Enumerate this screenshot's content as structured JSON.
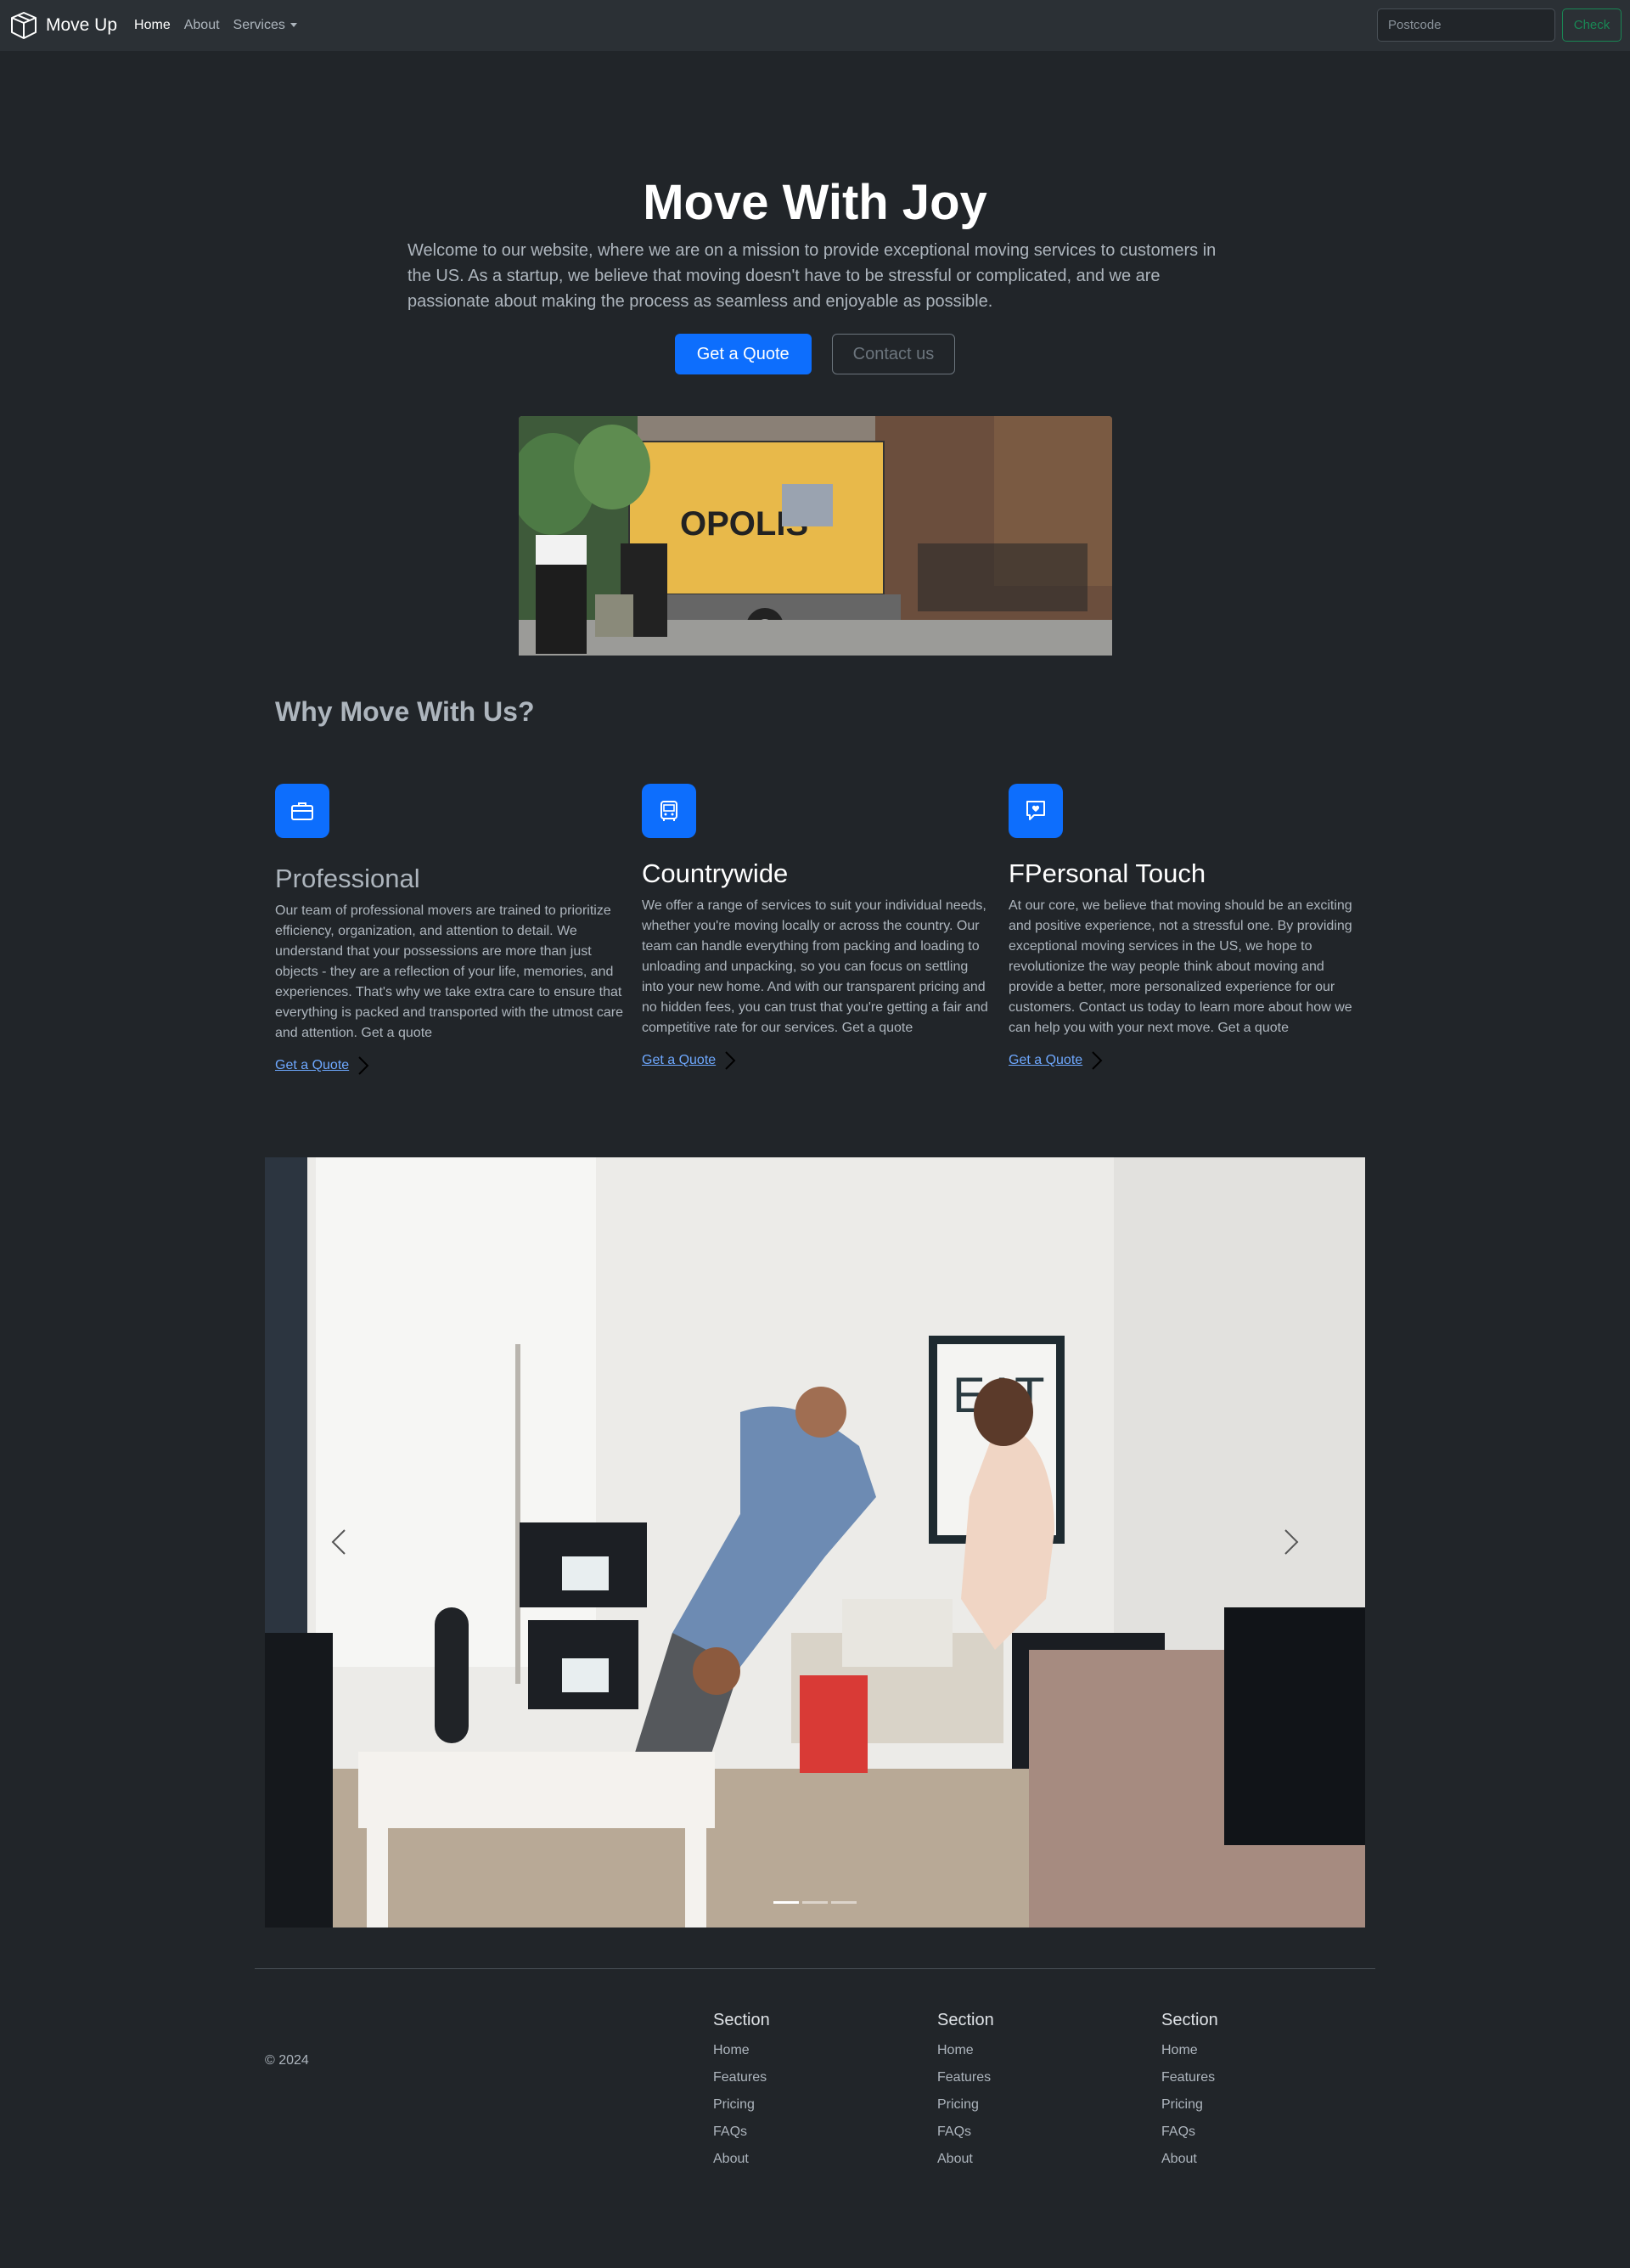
{
  "navbar": {
    "brand": "Move Up",
    "links": [
      {
        "label": "Home",
        "active": true
      },
      {
        "label": "About",
        "active": false
      }
    ],
    "services_label": "Services",
    "postcode_placeholder": "Postcode",
    "check_label": "Check"
  },
  "hero": {
    "title": "Move With Joy",
    "text": "Welcome to our website, where we are on a mission to provide exceptional moving services to customers in the US. As a startup, we believe that moving doesn't have to be stressful or complicated, and we are passionate about making the process as seamless and enjoyable as possible.",
    "primary_button": "Get a Quote",
    "secondary_button": "Contact us"
  },
  "why": {
    "title": "Why Move With Us?",
    "features": [
      {
        "icon": "briefcase-icon",
        "title": "Professional",
        "text": "Our team of professional movers are trained to prioritize efficiency, organization, and attention to detail. We understand that your possessions are more than just objects - they are a reflection of your life, memories, and experiences. That's why we take extra care to ensure that everything is packed and transported with the utmost care and attention. Get a quote",
        "link": "Get a Quote"
      },
      {
        "icon": "bus-icon",
        "title": "Countrywide",
        "text": "We offer a range of services to suit your individual needs, whether you're moving locally or across the country. Our team can handle everything from packing and loading to unloading and unpacking, so you can focus on settling into your new home. And with our transparent pricing and no hidden fees, you can trust that you're getting a fair and competitive rate for our services. Get a quote",
        "link": "Get a Quote"
      },
      {
        "icon": "heart-chat-icon",
        "title": "FPersonal Touch",
        "text": "At our core, we believe that moving should be an exciting and positive experience, not a stressful one. By providing exceptional moving services in the US, we hope to revolutionize the way people think about moving and provide a better, more personalized experience for our customers. Contact us today to learn more about how we can help you with your next move. Get a quote",
        "link": "Get a Quote"
      }
    ]
  },
  "carousel": {
    "slides": 3,
    "active": 0
  },
  "footer": {
    "copyright": "© 2024",
    "columns": [
      {
        "heading": "Section",
        "links": [
          "Home",
          "Features",
          "Pricing",
          "FAQs",
          "About"
        ]
      },
      {
        "heading": "Section",
        "links": [
          "Home",
          "Features",
          "Pricing",
          "FAQs",
          "About"
        ]
      },
      {
        "heading": "Section",
        "links": [
          "Home",
          "Features",
          "Pricing",
          "FAQs",
          "About"
        ]
      }
    ]
  },
  "colors": {
    "background": "#212529",
    "navbar": "#2b3035",
    "primary": "#0d6efd",
    "success": "#198754",
    "link": "#6ea8fe"
  }
}
